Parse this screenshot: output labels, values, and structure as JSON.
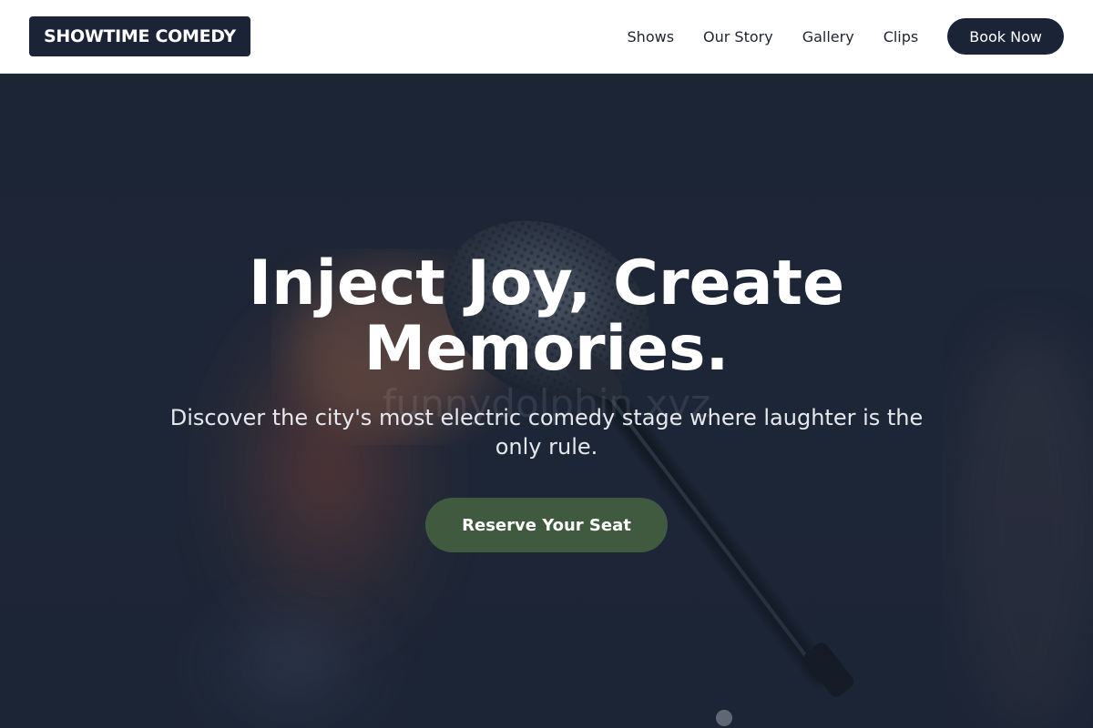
{
  "header": {
    "logo_text": "SHOWTIME COMEDY",
    "nav": [
      "Shows",
      "Our Story",
      "Gallery",
      "Clips"
    ],
    "book_label": "Book Now"
  },
  "hero": {
    "title_line1": "Inject Joy, Create",
    "title_line2": "Memories.",
    "subtitle": "Discover the city's most electric comedy stage where laughter is the only rule.",
    "cta_label": "Reserve Your Seat",
    "watermark": "funnydolphin.xyz"
  },
  "colors": {
    "brand_navy": "#1b2337",
    "cta_green": "#3f5a3f",
    "nav_background": "#ffffff"
  }
}
